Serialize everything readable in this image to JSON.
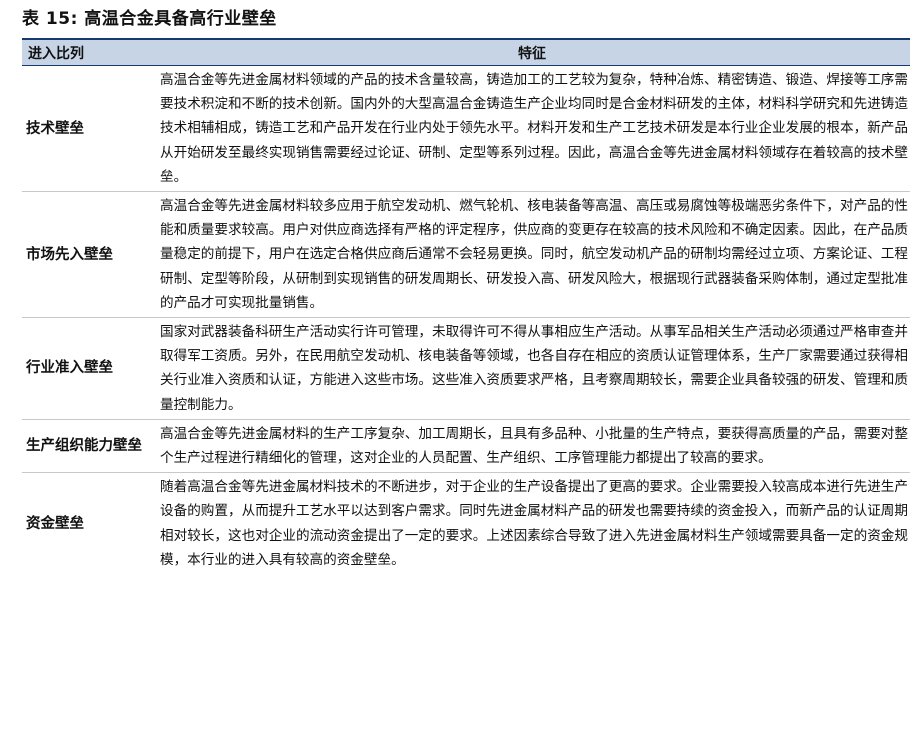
{
  "title": "表 15:  高温合金具备高行业壁垒",
  "table": {
    "headers": [
      "进入比列",
      "特征"
    ],
    "rows": [
      {
        "category": "技术壁垒",
        "description": "高温合金等先进金属材料领域的产品的技术含量较高，铸造加工的工艺较为复杂，特种冶炼、精密铸造、锻造、焊接等工序需要技术积淀和不断的技术创新。国内外的大型高温合金铸造生产企业均同时是合金材料研发的主体，材料科学研究和先进铸造技术相辅相成，铸造工艺和产品开发在行业内处于领先水平。材料开发和生产工艺技术研发是本行业企业发展的根本，新产品从开始研发至最终实现销售需要经过论证、研制、定型等系列过程。因此，高温合金等先进金属材料领域存在着较高的技术壁垒。"
      },
      {
        "category": "市场先入壁垒",
        "description": "高温合金等先进金属材料较多应用于航空发动机、燃气轮机、核电装备等高温、高压或易腐蚀等极端恶劣条件下，对产品的性能和质量要求较高。用户对供应商选择有严格的评定程序，供应商的变更存在较高的技术风险和不确定因素。因此，在产品质量稳定的前提下，用户在选定合格供应商后通常不会轻易更换。同时，航空发动机产品的研制均需经过立项、方案论证、工程研制、定型等阶段，从研制到实现销售的研发周期长、研发投入高、研发风险大，根据现行武器装备采购体制，通过定型批准的产品才可实现批量销售。"
      },
      {
        "category": "行业准入壁垒",
        "description": "国家对武器装备科研生产活动实行许可管理，未取得许可不得从事相应生产活动。从事军品相关生产活动必须通过严格审查并取得军工资质。另外，在民用航空发动机、核电装备等领域，也各自存在相应的资质认证管理体系，生产厂家需要通过获得相关行业准入资质和认证，方能进入这些市场。这些准入资质要求严格，且考察周期较长，需要企业具备较强的研发、管理和质量控制能力。"
      },
      {
        "category": "生产组织能力壁垒",
        "description": "高温合金等先进金属材料的生产工序复杂、加工周期长，且具有多品种、小批量的生产特点，要获得高质量的产品，需要对整个生产过程进行精细化的管理，这对企业的人员配置、生产组织、工序管理能力都提出了较高的要求。"
      },
      {
        "category": "资金壁垒",
        "description": "随着高温合金等先进金属材料技术的不断进步，对于企业的生产设备提出了更高的要求。企业需要投入较高成本进行先进生产设备的购置，从而提升工艺水平以达到客户需求。同时先进金属材料产品的研发也需要持续的资金投入，而新产品的认证周期相对较长，这也对企业的流动资金提出了一定的要求。上述因素综合导致了进入先进金属材料生产领域需要具备一定的资金规模，本行业的进入具有较高的资金壁垒。"
      }
    ]
  }
}
